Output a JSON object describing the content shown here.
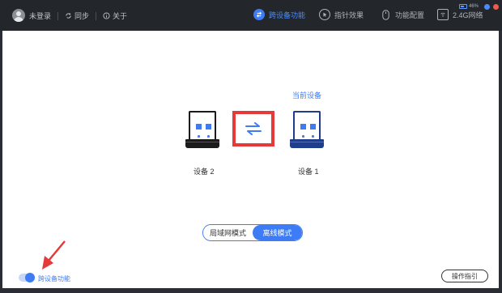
{
  "titlebar": {
    "user": "未登录",
    "sync": "同步",
    "about": "关于",
    "battery_percent": "46%",
    "nav": [
      {
        "label": "跨设备功能",
        "icon": "cross-device-icon",
        "active": true
      },
      {
        "label": "指针效果",
        "icon": "pointer-effect-icon",
        "active": false
      },
      {
        "label": "功能配置",
        "icon": "mouse-config-icon",
        "active": false
      },
      {
        "label": "2.4G网络",
        "icon": "wireless-2g4-icon",
        "active": false
      }
    ]
  },
  "main": {
    "current_device_label": "当前设备",
    "device_left": "设备 2",
    "device_right": "设备 1",
    "modes": [
      "局域网模式",
      "离线模式"
    ],
    "active_mode": "离线模式",
    "toggle_label": "跨设备功能",
    "toggle_on": true,
    "guide_button": "操作指引"
  },
  "colors": {
    "accent": "#3d7cf5",
    "highlight": "#e63a3a",
    "titlebar": "#23262b"
  }
}
